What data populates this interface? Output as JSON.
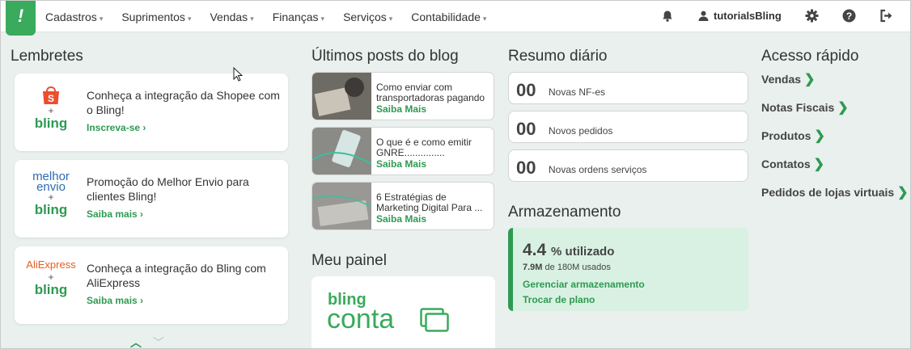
{
  "nav": {
    "items": [
      {
        "label": "Cadastros"
      },
      {
        "label": "Suprimentos"
      },
      {
        "label": "Vendas"
      },
      {
        "label": "Finanças"
      },
      {
        "label": "Serviços"
      },
      {
        "label": "Contabilidade"
      }
    ],
    "user": "tutorialsBling",
    "icons": [
      "bell-icon",
      "user-icon",
      "gear-icon",
      "help-icon",
      "logout-icon"
    ]
  },
  "reminders": {
    "title": "Lembretes",
    "cards": [
      {
        "partner": "Shopee",
        "text": "Conheça a integração da Shopee com o Bling!",
        "link": "Inscreva-se"
      },
      {
        "partner": "Melhor Envio",
        "text": "Promoção do Melhor Envio para clientes Bling!",
        "link": "Saiba mais"
      },
      {
        "partner": "AliExpress",
        "text": "Conheça a integração do Bling com AliExpress",
        "link": "Saiba mais"
      }
    ],
    "logo_text": {
      "bling": "bling",
      "plus": "+",
      "melhor": "melhor",
      "envio": "envio",
      "aliexpress": "AliExpress"
    }
  },
  "blog": {
    "title": "Últimos posts do blog",
    "posts": [
      {
        "text": "Como enviar com transportadoras pagando ...",
        "link": "Saiba Mais"
      },
      {
        "text": "O que é e como emitir GNRE...............",
        "link": "Saiba Mais"
      },
      {
        "text": "6 Estratégias de Marketing Digital Para ...",
        "link": "Saiba Mais"
      }
    ]
  },
  "painel": {
    "title": "Meu painel",
    "brand_top": "bling",
    "brand_bottom": "conta"
  },
  "resumo": {
    "title": "Resumo diário",
    "items": [
      {
        "count": "00",
        "label": "Novas NF-es"
      },
      {
        "count": "00",
        "label": "Novos pedidos"
      },
      {
        "count": "00",
        "label": "Novas ordens serviços"
      }
    ]
  },
  "storage": {
    "title": "Armazenamento",
    "percent": "4.4",
    "percent_suffix": "% utilizado",
    "used": "7.9M",
    "used_suffix": "de 180M usados",
    "manage_link": "Gerenciar armazenamento",
    "plan_link": "Trocar de plano"
  },
  "quick_access": {
    "title": "Acesso rápido",
    "items": [
      "Vendas",
      "Notas Fiscais",
      "Produtos",
      "Contatos",
      "Pedidos de lojas virtuais"
    ]
  },
  "colors": {
    "accent": "#2e9a52",
    "logo_bg": "#3aaa5c",
    "page_bg": "#e9f0ee",
    "storage_bg": "#d9f1e2"
  }
}
